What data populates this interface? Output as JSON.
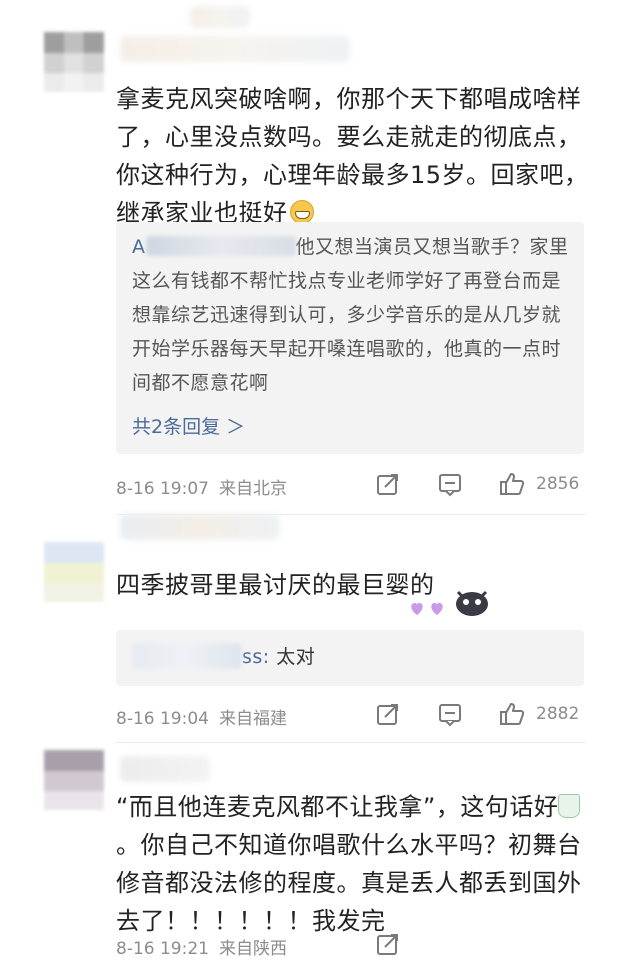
{
  "comments": [
    {
      "text": "拿麦克风突破啥啊，你那个天下都唱成啥样了，心里没点数吗。要么走就走的彻底点，你这种行为，心理年龄最多15岁。回家吧，继承家业也挺好",
      "emoji": "grin-emoji",
      "reply": {
        "author": "A",
        "text": "他又想当演员又想当歌手？家里这么有钱都不帮忙找点专业老师学好了再登台而是想靠综艺迅速得到认可，多少学音乐的是从几岁就开始学乐器每天早起开嗓连唱歌的，他真的一点时间都不愿意花啊",
        "more": "共2条回复 ＞"
      },
      "time": "8-16 19:07",
      "location": "来自北京",
      "likes": "2856"
    },
    {
      "text": "四季披哥里最讨厌的最巨婴的",
      "reply": {
        "author_suffix": "ss:",
        "text": " 太对"
      },
      "time": "8-16 19:04",
      "location": "来自福建",
      "likes": "2882"
    },
    {
      "text_line1": "“而且他连麦克风都不让我拿”，这句话好",
      "text_rest": "。你自己不知道你唱歌什么水平吗？初舞台修音都没法修的程度。真是丢人都丢到国外去了！！！！！！我发完",
      "time": "8-16 19:21",
      "location": "来自陕西"
    }
  ],
  "colors": {
    "meta": "#8c8c8c",
    "link": "#4a6a9b",
    "reply_bg": "#f3f3f3"
  },
  "icons": {
    "share": "share-icon",
    "comment": "comment-icon",
    "like": "thumbs-up-icon"
  }
}
